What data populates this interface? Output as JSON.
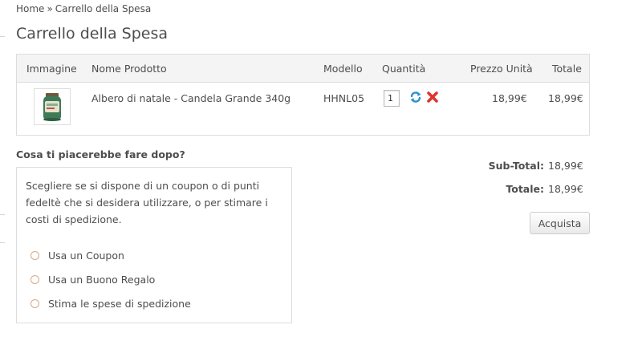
{
  "breadcrumb": {
    "home": "Home",
    "separator": "»",
    "current": "Carrello della Spesa"
  },
  "page_title": "Carrello della Spesa",
  "cart": {
    "headers": {
      "image": "Immagine",
      "name": "Nome Prodotto",
      "model": "Modello",
      "quantity": "Quantità",
      "unit_price": "Prezzo Unità",
      "total": "Totale"
    },
    "items": [
      {
        "image_icon": "candle-jar-thumbnail",
        "name": "Albero di natale - Candela Grande 340g",
        "model": "HHNL05",
        "quantity": "1",
        "unit_price": "18,99€",
        "total": "18,99€",
        "update_icon": "refresh-icon",
        "remove_icon": "remove-icon"
      }
    ]
  },
  "next_steps": {
    "heading": "Cosa ti piacerebbe fare dopo?",
    "description": "Scegliere se si dispone di un coupon o di punti fedeltè che si desidera utilizzare, o per stimare i costi di spedizione.",
    "options": [
      {
        "label": "Usa un Coupon"
      },
      {
        "label": "Usa un Buono Regalo"
      },
      {
        "label": "Stima le spese di spedizione"
      }
    ]
  },
  "totals": {
    "subtotal_label": "Sub-Total:",
    "subtotal_value": "18,99€",
    "total_label": "Totale:",
    "total_value": "18,99€"
  },
  "checkout_label": "Acquista",
  "colors": {
    "text": "#4d4d4d",
    "header_bg": "#f4f4f4",
    "border": "#dddddd",
    "refresh_icon": "#2e8fd6",
    "remove_icon": "#e0352b",
    "radio_border": "#d9a882"
  }
}
